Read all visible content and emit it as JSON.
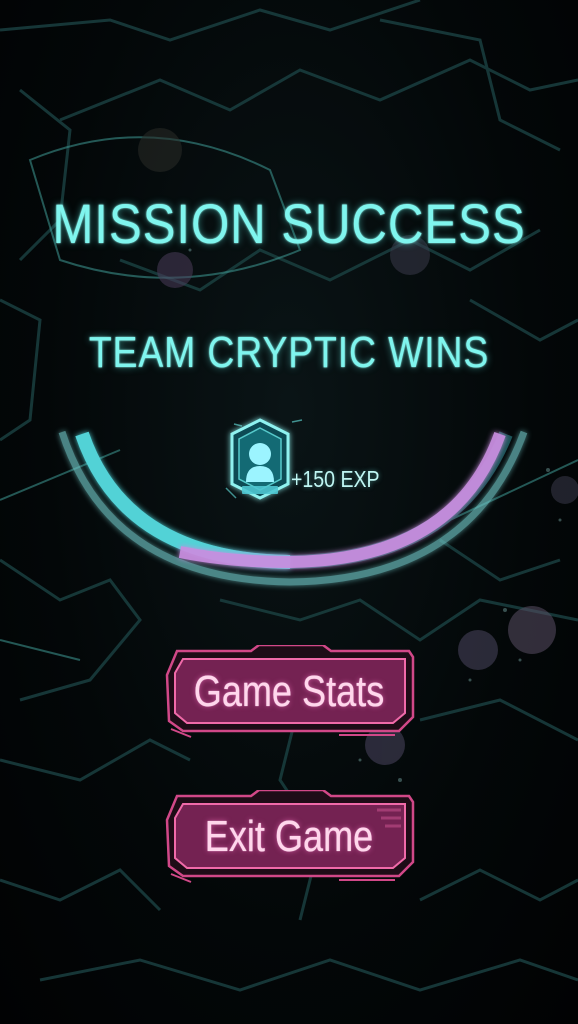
{
  "screen": {
    "title": "MISSION SUCCESS",
    "subtitle": "TEAM CRYPTIC WINS"
  },
  "reward": {
    "exp_text": "+150 EXP",
    "icon": "player-avatar-hexagon-icon",
    "progress_fraction": 0.55
  },
  "menu": {
    "game_stats_label": "Game Stats",
    "exit_game_label": "Exit Game"
  },
  "colors": {
    "accent_cyan": "#7ff5ee",
    "progress_pink": "#c98ee0",
    "button_fill": "#7a2352",
    "button_border": "#e04d93",
    "map_lines": "#1d4a4a"
  }
}
